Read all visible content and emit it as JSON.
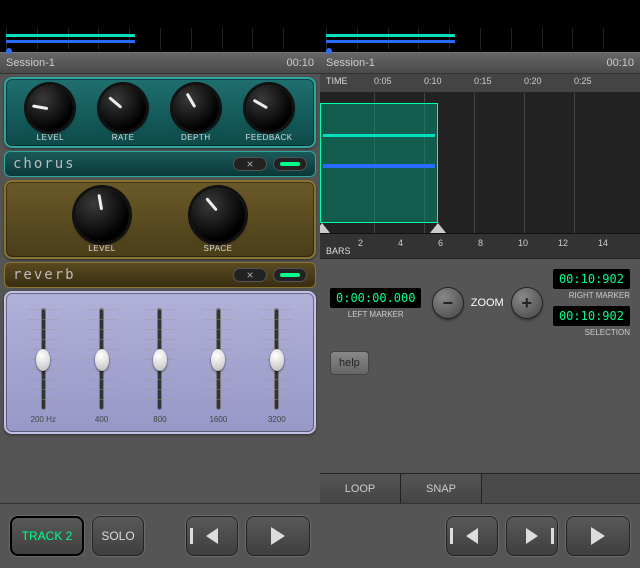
{
  "left": {
    "session": "Session-1",
    "time": "00:10",
    "chorus": {
      "name": "chorus",
      "knobs": [
        {
          "label": "LEVEL",
          "angle": -80
        },
        {
          "label": "RATE",
          "angle": -50
        },
        {
          "label": "DEPTH",
          "angle": -30
        },
        {
          "label": "FEEDBACK",
          "angle": -60
        }
      ]
    },
    "reverb": {
      "name": "reverb",
      "knobs": [
        {
          "label": "LEVEL",
          "angle": -10
        },
        {
          "label": "SPACE",
          "angle": -40
        }
      ]
    },
    "eq": {
      "bands": [
        "200 Hz",
        "400",
        "800",
        "1600",
        "3200"
      ]
    },
    "track_btn": "TRACK 2",
    "solo_btn": "SOLO"
  },
  "right": {
    "session": "Session-1",
    "time": "00:10",
    "time_label": "TIME",
    "time_ticks": [
      "0:05",
      "0:10",
      "0:15",
      "0:20",
      "0:25"
    ],
    "bars_label": "BARS",
    "bars_ticks": [
      "2",
      "4",
      "6",
      "8",
      "10",
      "12",
      "14"
    ],
    "left_marker": {
      "value": "0:00:00.000",
      "label": "LEFT MARKER"
    },
    "right_marker": {
      "value": "00:10:902",
      "label": "RIGHT MARKER"
    },
    "selection": {
      "value": "00:10:902",
      "label": "SELECTION"
    },
    "zoom_label": "ZOOM",
    "help": "help",
    "tabs": [
      "LOOP",
      "SNAP"
    ]
  }
}
